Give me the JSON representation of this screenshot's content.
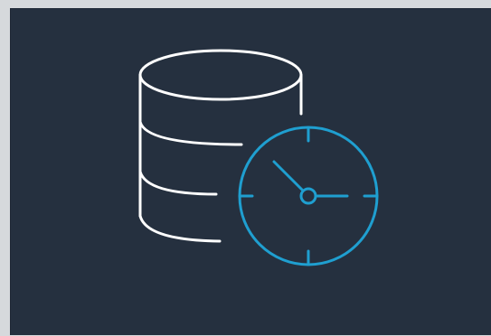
{
  "panel": {
    "background": "#25303f",
    "frame_color": "#d6d9dc"
  },
  "illustration": {
    "icons": [
      "database-icon",
      "clock-icon"
    ],
    "database_stroke": "#ffffff",
    "clock_stroke": "#1f9fd0"
  }
}
